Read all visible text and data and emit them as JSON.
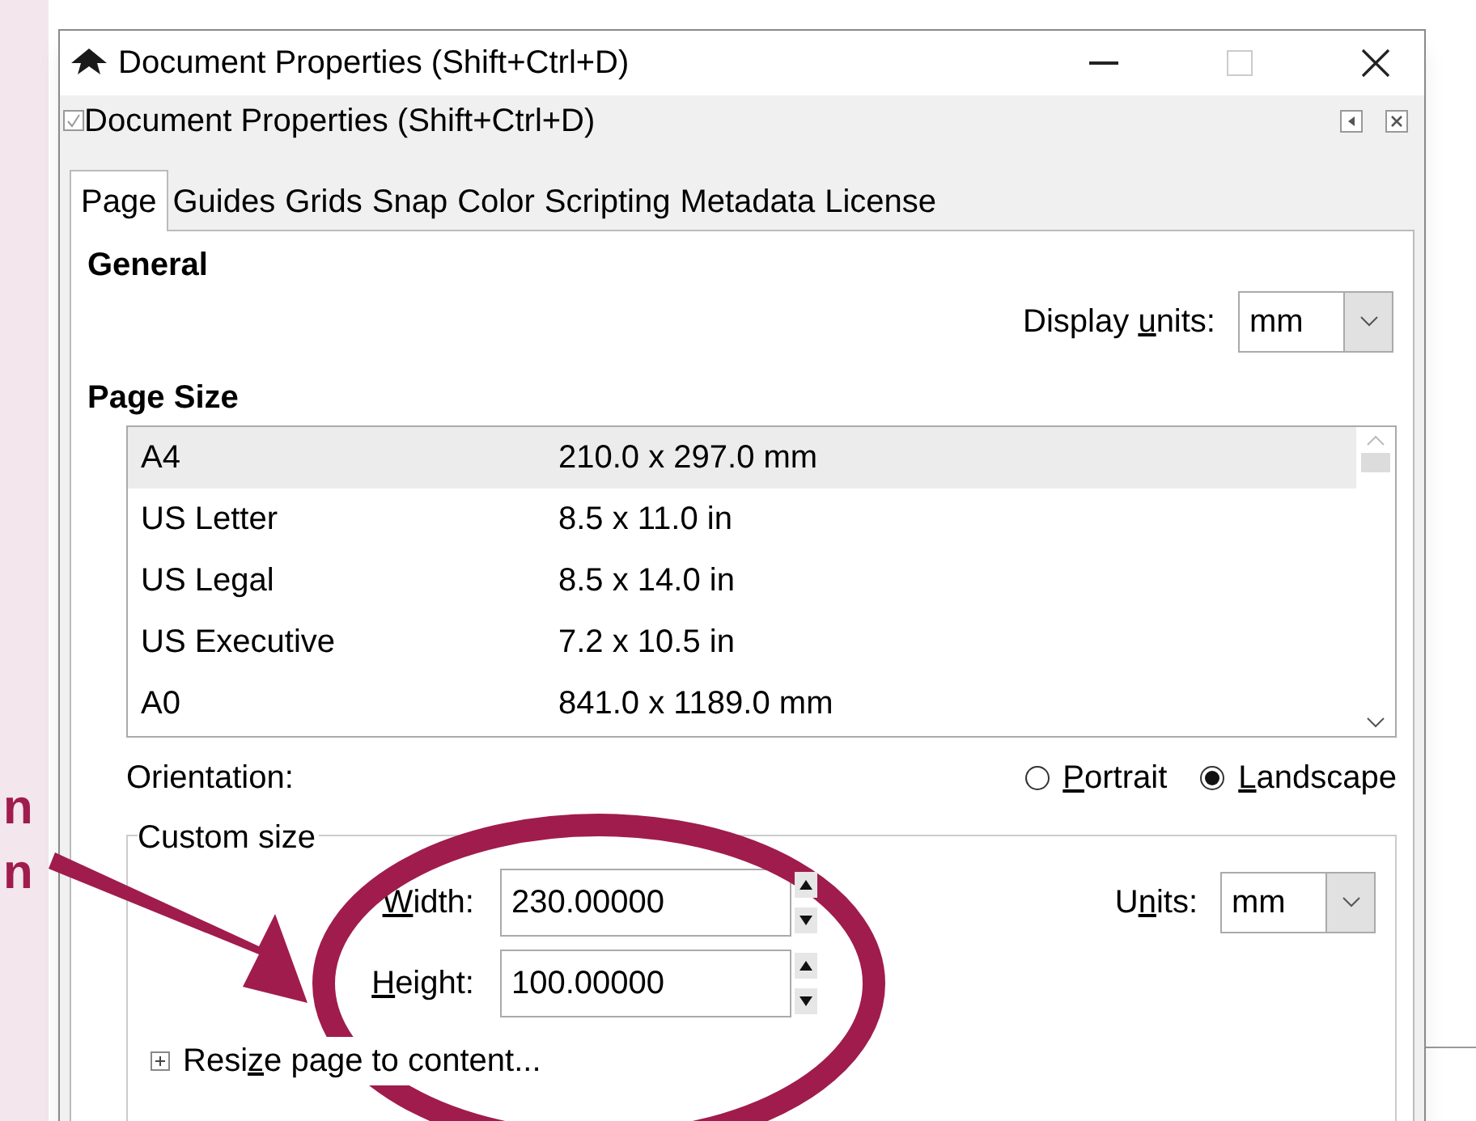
{
  "annotation_text": [
    "n",
    "n"
  ],
  "window": {
    "title": "Document Properties (Shift+Ctrl+D)"
  },
  "panel": {
    "title": "Document Properties (Shift+Ctrl+D)"
  },
  "tabs": [
    {
      "label": "Page",
      "selected": true
    },
    {
      "label": "Guides",
      "selected": false
    },
    {
      "label": "Grids",
      "selected": false
    },
    {
      "label": "Snap",
      "selected": false
    },
    {
      "label": "Color",
      "selected": false
    },
    {
      "label": "Scripting",
      "selected": false
    },
    {
      "label": "Metadata",
      "selected": false
    },
    {
      "label": "License",
      "selected": false
    }
  ],
  "general": {
    "heading": "General",
    "display_units": {
      "label": [
        {
          "text": "Display ",
          "underlined": false
        },
        {
          "text": "u",
          "underlined": true
        },
        {
          "text": "nits:",
          "underlined": false
        }
      ],
      "value": "mm"
    }
  },
  "page_size": {
    "heading": "Page Size",
    "rows": [
      {
        "name": "A4",
        "size": "210.0 x 297.0 mm",
        "selected": true
      },
      {
        "name": "US Letter",
        "size": "8.5 x 11.0 in",
        "selected": false
      },
      {
        "name": "US Legal",
        "size": "8.5 x 14.0 in",
        "selected": false
      },
      {
        "name": "US Executive",
        "size": "7.2 x 10.5 in",
        "selected": false
      },
      {
        "name": "A0",
        "size": "841.0 x 1189.0 mm",
        "selected": false
      }
    ]
  },
  "orientation": {
    "label": "Orientation:",
    "options": [
      {
        "label": [
          {
            "text": "P",
            "underlined": true
          },
          {
            "text": "ortrait",
            "underlined": false
          }
        ],
        "selected": false
      },
      {
        "label": [
          {
            "text": "L",
            "underlined": true
          },
          {
            "text": "andscape",
            "underlined": false
          }
        ],
        "selected": true
      }
    ]
  },
  "custom_size": {
    "legend": "Custom size",
    "width": {
      "label": [
        {
          "text": "W",
          "underlined": true
        },
        {
          "text": "idth:",
          "underlined": false
        }
      ],
      "value": "230.00000"
    },
    "height": {
      "label": [
        {
          "text": "H",
          "underlined": true
        },
        {
          "text": "eight:",
          "underlined": false
        }
      ],
      "value": "100.00000"
    },
    "units": {
      "label": [
        {
          "text": "U",
          "underlined": false
        },
        {
          "text": "n",
          "underlined": true
        },
        {
          "text": "its:",
          "underlined": false
        }
      ],
      "value": "mm"
    },
    "resize": {
      "label": [
        {
          "text": "Resi",
          "underlined": false
        },
        {
          "text": "z",
          "underlined": true
        },
        {
          "text": "e page to content...",
          "underlined": false
        }
      ],
      "expanded": false
    }
  }
}
